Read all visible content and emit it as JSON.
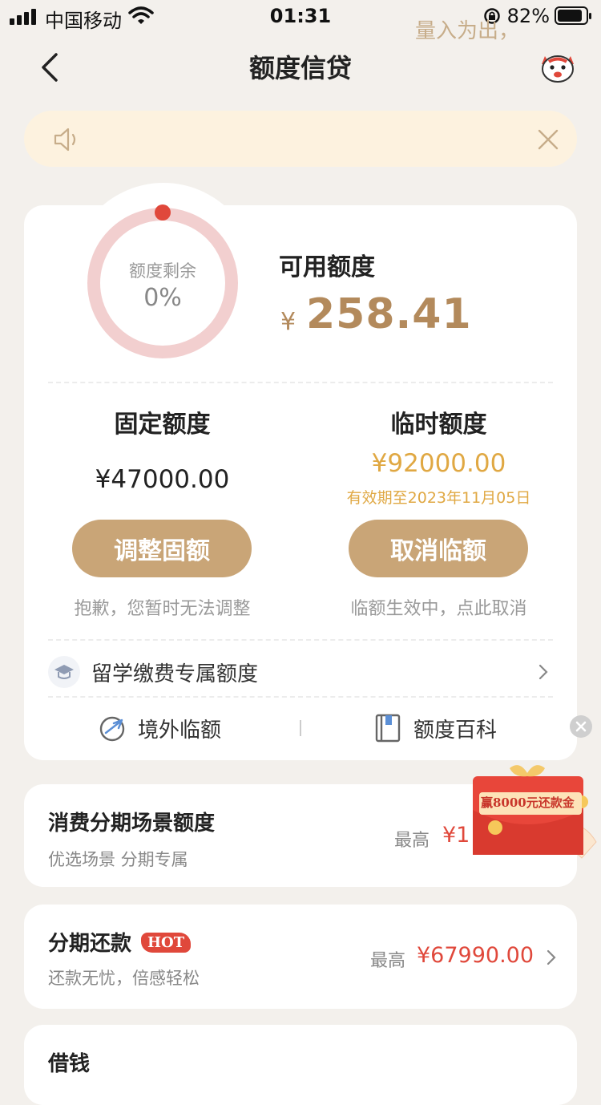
{
  "status_bar": {
    "carrier": "中国移动",
    "time": "01:31",
    "battery": "82%"
  },
  "nav": {
    "title": "额度信贷"
  },
  "notice": {
    "text": "量入为出，"
  },
  "credit": {
    "ring_label": "额度剩余",
    "ring_percent": "0%",
    "ring_remaining_fraction": 0,
    "available_label": "可用额度",
    "currency": "¥",
    "available_amount": "258.41"
  },
  "fixed": {
    "title": "固定额度",
    "amount": "¥47000.00",
    "button": "调整固额",
    "tip": "抱歉，您暂时无法调整"
  },
  "temporary": {
    "title": "临时额度",
    "amount": "¥92000.00",
    "validity": "有效期至2023年11月05日",
    "button": "取消临额",
    "tip": "临额生效中，点此取消"
  },
  "study": {
    "label": "留学缴费专属额度"
  },
  "links": {
    "overseas": "境外临额",
    "encyclopedia": "额度百科"
  },
  "promo": {
    "text": "赢8000元还款金"
  },
  "items": [
    {
      "title": "消费分期场景额度",
      "subtitle": "优选场景 分期专属",
      "right_label": "最高",
      "right_value": "¥1"
    },
    {
      "title": "分期还款",
      "badge": "HOT",
      "subtitle": "还款无忧，倍感轻松",
      "right_label": "最高",
      "right_value": "¥67990.00"
    },
    {
      "title": "借钱"
    }
  ],
  "colors": {
    "accent": "#c9a577",
    "gold_text": "#b38a5c",
    "red": "#e0483b",
    "temp_amount": "#e0a843",
    "ring": "#f2cfcf",
    "ring_dot": "#e0483b"
  },
  "icons": [
    "signal-icon",
    "wifi-icon",
    "lock-rotation-icon",
    "battery-icon",
    "back-chevron-icon",
    "mascot-icon",
    "speaker-icon",
    "close-icon",
    "ring-gauge",
    "graduation-cap-icon",
    "chevron-right-icon",
    "globe-plane-icon",
    "book-icon",
    "gift-envelope-icon"
  ]
}
